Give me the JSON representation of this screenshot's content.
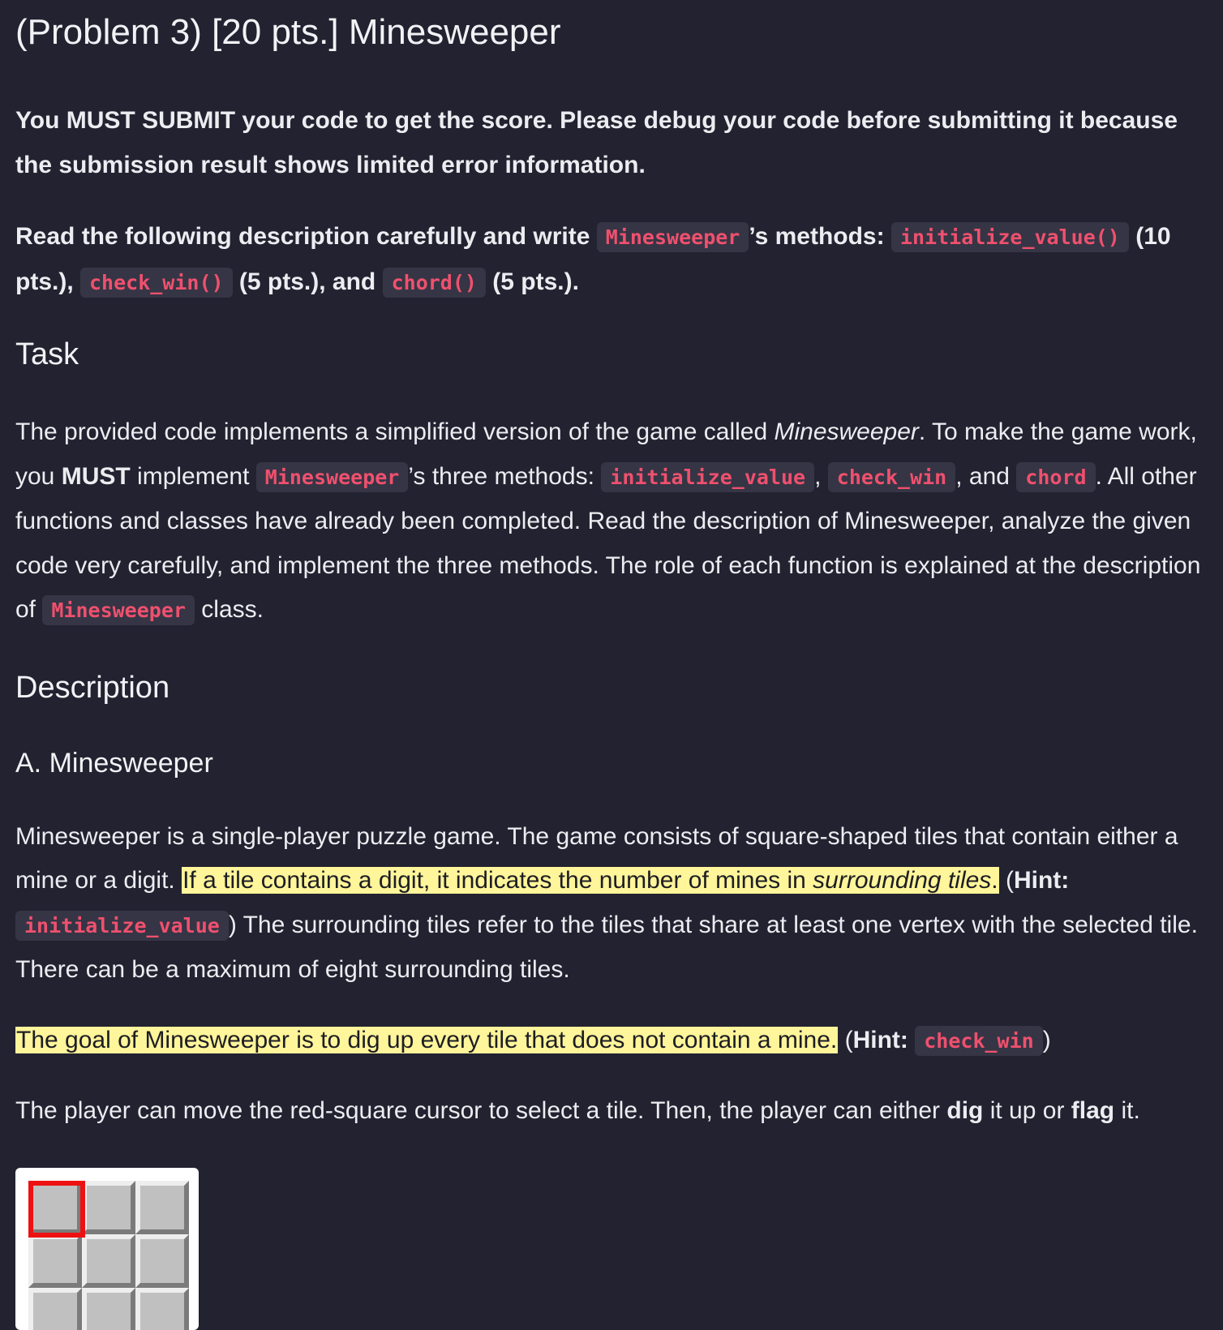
{
  "title": "(Problem 3) [20 pts.] Minesweeper",
  "intro": {
    "line1": "You MUST SUBMIT your code to get the score. Please debug your code before submitting it because the submission result shows limited error information.",
    "line2_pre": "Read the following description carefully and write ",
    "class_name": "Minesweeper",
    "line2_mid": "’s methods: ",
    "method1": "initialize_value()",
    "method1_pts": " (10 pts.), ",
    "method2": "check_win()",
    "method2_pts": " (5 pts.), and ",
    "method3": "chord()",
    "method3_pts": " (5 pts.)."
  },
  "task": {
    "heading": "Task",
    "p1": "The provided code implements a simplified version of the game called ",
    "game_italic": "Minesweeper",
    "p2": ". To make the game work, you ",
    "must": "MUST",
    "p3": " implement ",
    "class_name": "Minesweeper",
    "p4": "’s three methods: ",
    "m1": "initialize_value",
    "sep1": ", ",
    "m2": "check_win",
    "sep2": ", and ",
    "m3": "chord",
    "p5": ". All other functions and classes have already been completed. Read the description of Minesweeper, analyze the given code very carefully, and implement the three methods. The role of each function is explained at the description of ",
    "class_name2": "Minesweeper",
    "p6": " class."
  },
  "description": {
    "heading": "Description",
    "sub_heading": "A. Minesweeper",
    "para1": {
      "t1": "Minesweeper is a single-player puzzle game. The game consists of square-shaped tiles that contain either a mine or a digit. ",
      "hl1": "If a tile contains a digit, it indicates the number of mines in ",
      "hl_italic": "surrounding tiles",
      "hl2": ".",
      "t2": " (",
      "hint": "Hint:",
      "code": "initialize_value",
      "t3": ") The surrounding tiles refer to the tiles that share at least one vertex with the selected tile. There can be a maximum of eight surrounding tiles."
    },
    "para2": {
      "hl": "The goal of Minesweeper is to dig up every tile that does not contain a mine.",
      "t1": " (",
      "hint": "Hint:",
      "code": "check_win",
      "t2": ")"
    },
    "para3": {
      "t1": "The player can move the red-square cursor to select a tile. Then, the player can either ",
      "dig": "dig",
      "t2": " it up or ",
      "flag": "flag",
      "t3": " it."
    }
  },
  "figure": {
    "colors": {
      "tile": "#c0c0c0",
      "cursor": "#ee1111",
      "background": "#ffffff"
    }
  }
}
